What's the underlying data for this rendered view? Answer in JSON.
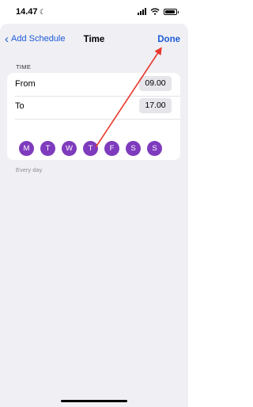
{
  "status_bar": {
    "time": "14.47",
    "moon": "☾"
  },
  "nav": {
    "back_label": "Add Schedule",
    "back_chevron": "‹",
    "title": "Time",
    "done_label": "Done"
  },
  "section": {
    "header": "TIME"
  },
  "rows": [
    {
      "label": "From",
      "value": "09.00"
    },
    {
      "label": "To",
      "value": "17.00"
    }
  ],
  "days": [
    "M",
    "T",
    "W",
    "T",
    "F",
    "S",
    "S"
  ],
  "footer": "Every day",
  "colors": {
    "accent": "#1e5bd6",
    "day_fill": "#7e3bbd",
    "annotation": "#e8372b",
    "sheet_bg": "#efeff4"
  }
}
